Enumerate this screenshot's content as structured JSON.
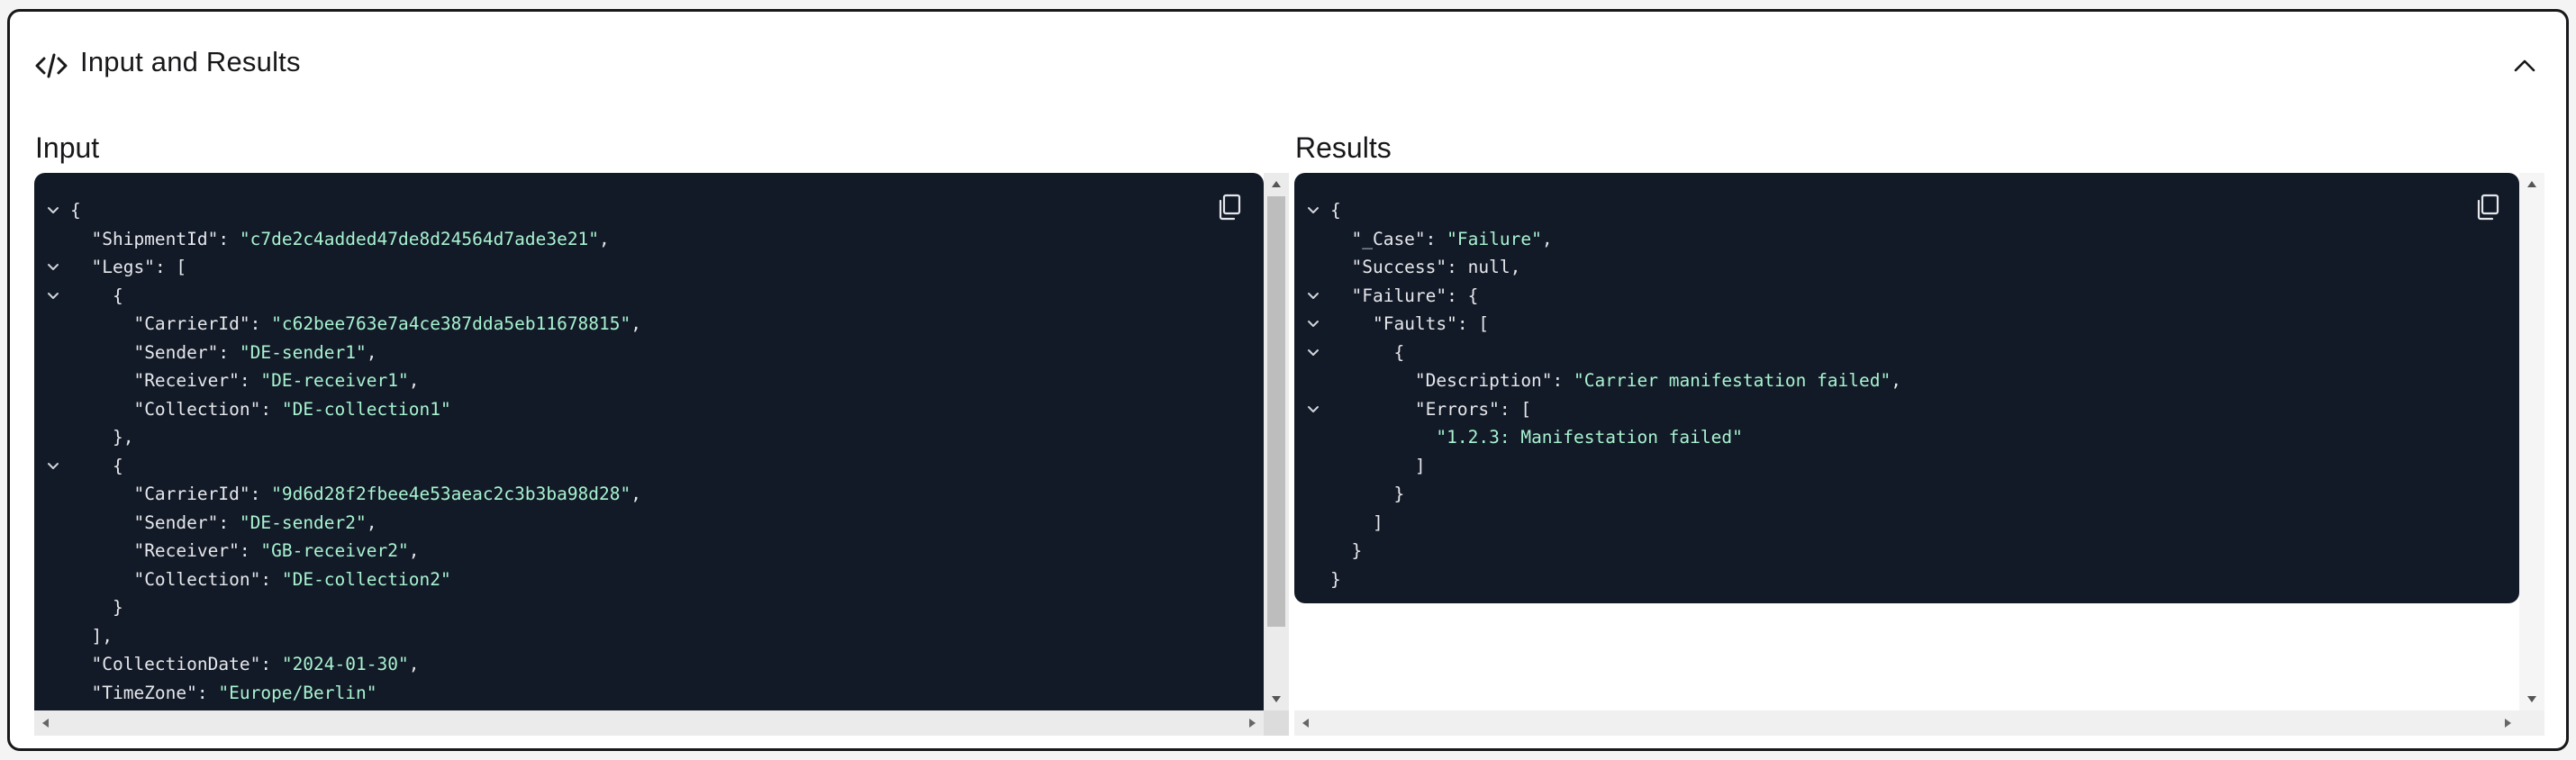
{
  "header": {
    "title": "Input and Results",
    "icon": "code-icon",
    "collapse_icon": "chevron-up-icon"
  },
  "input": {
    "label": "Input",
    "copy_icon": "copy-icon",
    "lines": [
      {
        "fold": true,
        "text": "{"
      },
      {
        "fold": false,
        "text": "  \"ShipmentId\": \"c7de2c4added47de8d24564d7ade3e21\","
      },
      {
        "fold": true,
        "text": "  \"Legs\": ["
      },
      {
        "fold": true,
        "text": "    {"
      },
      {
        "fold": false,
        "text": "      \"CarrierId\": \"c62bee763e7a4ce387dda5eb11678815\","
      },
      {
        "fold": false,
        "text": "      \"Sender\": \"DE-sender1\","
      },
      {
        "fold": false,
        "text": "      \"Receiver\": \"DE-receiver1\","
      },
      {
        "fold": false,
        "text": "      \"Collection\": \"DE-collection1\""
      },
      {
        "fold": false,
        "text": "    },"
      },
      {
        "fold": true,
        "text": "    {"
      },
      {
        "fold": false,
        "text": "      \"CarrierId\": \"9d6d28f2fbee4e53aeac2c3b3ba98d28\","
      },
      {
        "fold": false,
        "text": "      \"Sender\": \"DE-sender2\","
      },
      {
        "fold": false,
        "text": "      \"Receiver\": \"GB-receiver2\","
      },
      {
        "fold": false,
        "text": "      \"Collection\": \"DE-collection2\""
      },
      {
        "fold": false,
        "text": "    }"
      },
      {
        "fold": false,
        "text": "  ],"
      },
      {
        "fold": false,
        "text": "  \"CollectionDate\": \"2024-01-30\","
      },
      {
        "fold": false,
        "text": "  \"TimeZone\": \"Europe/Berlin\""
      }
    ]
  },
  "results": {
    "label": "Results",
    "copy_icon": "copy-icon",
    "lines": [
      {
        "fold": true,
        "text": "{"
      },
      {
        "fold": false,
        "text": "  \"_Case\": \"Failure\","
      },
      {
        "fold": false,
        "text": "  \"Success\": null,"
      },
      {
        "fold": true,
        "text": "  \"Failure\": {"
      },
      {
        "fold": true,
        "text": "    \"Faults\": ["
      },
      {
        "fold": true,
        "text": "      {"
      },
      {
        "fold": false,
        "text": "        \"Description\": \"Carrier manifestation failed\","
      },
      {
        "fold": true,
        "text": "        \"Errors\": ["
      },
      {
        "fold": false,
        "text": "          \"1.2.3: Manifestation failed\""
      },
      {
        "fold": false,
        "text": "        ]"
      },
      {
        "fold": false,
        "text": "      }"
      },
      {
        "fold": false,
        "text": "    ]"
      },
      {
        "fold": false,
        "text": "  }"
      },
      {
        "fold": false,
        "text": "}"
      }
    ]
  },
  "colors": {
    "editor_bg": "#131a27",
    "key": "#e5e7eb",
    "string": "#a7f3d0"
  }
}
